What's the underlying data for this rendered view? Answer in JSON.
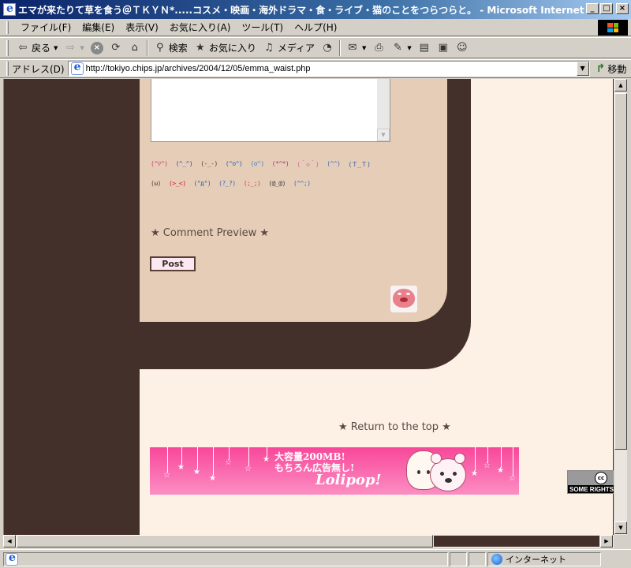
{
  "window": {
    "title": "エマが来たりて草を食う＠ＴＫＹＮ*.....コスメ・映画・海外ドラマ・食・ライブ・猫のことをつらつらと。 - Microsoft Internet Explorer",
    "btn_min": "_",
    "btn_max": "□",
    "btn_close": "×"
  },
  "menu": {
    "items": [
      "ファイル(F)",
      "編集(E)",
      "表示(V)",
      "お気に入り(A)",
      "ツール(T)",
      "ヘルプ(H)"
    ]
  },
  "toolbar": {
    "back_label": "戻る",
    "search_label": "検索",
    "favorites_label": "お気に入り",
    "media_label": "メディア"
  },
  "address": {
    "label": "アドレス(D)",
    "url": "http://tokiyo.chips.jp/archives/2004/12/05/emma_waist.php",
    "go_label": "移動"
  },
  "page": {
    "emoticons_row1": [
      "(^▽^)",
      "(^_^)",
      "(-_-)",
      "(^o^)",
      "(o^)",
      "(*^*)",
      "(＾◇＾)",
      "(^^)",
      "(Ｔ_Ｔ)"
    ],
    "emoticons_row2": [
      "(ω)",
      "(>_<)",
      "(°д°)",
      "(?_?)",
      "(;_;)",
      "(@_@)",
      "(^^;)"
    ],
    "comment_preview": "★ Comment Preview ★",
    "post_label": "Post",
    "return_top": "★ Return to the top ★",
    "banner": {
      "line1": "大容量200MB!",
      "line2": "もちろん広告無し!",
      "brand": "Lolipop!"
    },
    "cc_badge": {
      "mark": "cc",
      "text": "SOME RIGHTS RESERVED"
    }
  },
  "scroll": {
    "up": "▲",
    "down": "▼",
    "left": "◀",
    "right": "▶"
  },
  "status": {
    "zone_label": "インターネット"
  },
  "colors": {
    "dark_brown": "#44302a",
    "panel_tan": "#e5cdb8",
    "page_cream": "#fdf0e4",
    "banner_pink": "#f8479a"
  }
}
